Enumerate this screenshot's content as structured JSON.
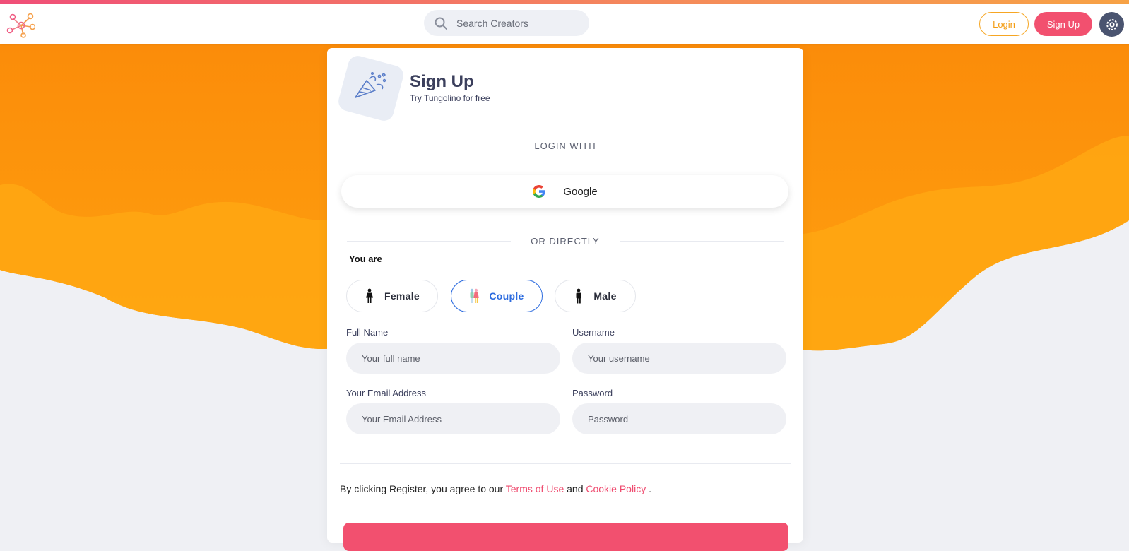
{
  "header": {
    "search_placeholder": "Search Creators",
    "login_label": "Login",
    "signup_label": "Sign Up",
    "logo_icon": "network-nodes-icon",
    "search_icon": "search-icon",
    "settings_icon": "gear-icon"
  },
  "card": {
    "title": "Sign Up",
    "subtitle": "Try Tungolino for free",
    "icon": "party-popper-icon",
    "login_with_label": "LOGIN WITH",
    "google_label": "Google",
    "or_directly_label": "OR DIRECTLY",
    "you_are_label": "You are",
    "genders": [
      {
        "label": "Female",
        "icon": "female-icon",
        "selected": false
      },
      {
        "label": "Couple",
        "icon": "couple-icon",
        "selected": true
      },
      {
        "label": "Male",
        "icon": "male-icon",
        "selected": false
      }
    ],
    "fields": {
      "full_name_label": "Full Name",
      "full_name_placeholder": "Your full name",
      "username_label": "Username",
      "username_placeholder": "Your username",
      "email_label": "Your Email Address",
      "email_placeholder": "Your Email Address",
      "password_label": "Password",
      "password_placeholder": "Password"
    },
    "terms": {
      "prefix": "By clicking Register, you agree to our",
      "terms_link": "Terms of Use",
      "and": "and",
      "cookie_link": "Cookie Policy",
      "suffix": "."
    }
  },
  "colors": {
    "accent_pink": "#f2506f",
    "accent_orange": "#f39c12",
    "selected_blue": "#2d6cdf",
    "settings_bg": "#4a5470"
  }
}
